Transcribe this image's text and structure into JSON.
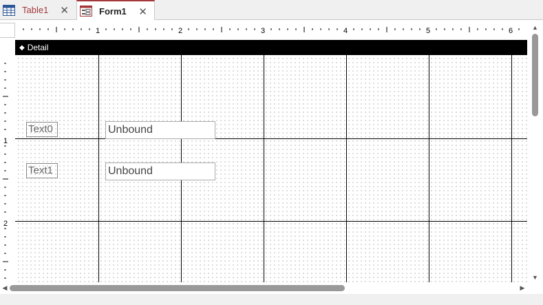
{
  "tabs": [
    {
      "label": "Table1",
      "icon": "table-icon",
      "active": false
    },
    {
      "label": "Form1",
      "icon": "form-icon",
      "active": true
    }
  ],
  "close_glyph": "✕",
  "ruler": {
    "horizontal_labels": [
      "1",
      "2",
      "3",
      "4",
      "5",
      "6"
    ],
    "vertical_labels": [
      "1",
      "2"
    ]
  },
  "section": {
    "label": "Detail",
    "icon": "collapse-arrow-icon"
  },
  "controls": [
    {
      "label": "Text0",
      "value": "Unbound"
    },
    {
      "label": "Text1",
      "value": "Unbound"
    }
  ],
  "colors": {
    "accent": "#a4373a",
    "section_bar": "#000000"
  }
}
